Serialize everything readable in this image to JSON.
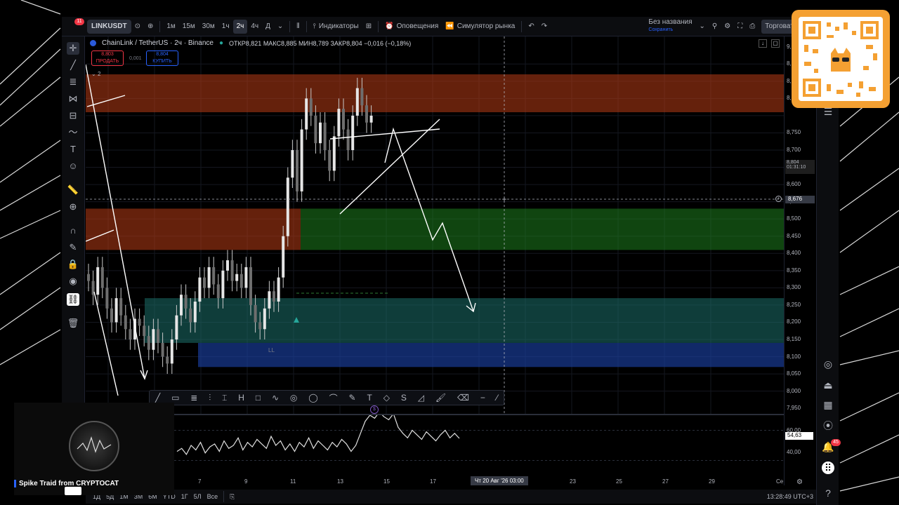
{
  "topbar": {
    "symbol": "LINKUSDT",
    "notification_count": "11",
    "intervals": [
      "1м",
      "15м",
      "30м",
      "1ч",
      "2ч",
      "4ч",
      "Д"
    ],
    "active_interval": "2ч",
    "indicators_label": "Индикаторы",
    "alerts_label": "Оповещения",
    "replay_label": "Симулятор рынка",
    "layout_name": "Без названия",
    "layout_status": "Сохранить",
    "trade_label": "Торговать"
  },
  "legend": {
    "title": "ChainLink / TetherUS · 2ч · Binance",
    "ohlc": "ОТКР8,821 МАКС8,885 МИН8,789 ЗАКР8,804 −0,016 (−0,18%)",
    "sell_price": "8,803",
    "sell_label": "ПРОДАТЬ",
    "spread": "0,001",
    "buy_price": "8,804",
    "buy_label": "КУПИТЬ",
    "collapse": "2"
  },
  "price_axis": {
    "labels": [
      "9,000",
      "8,950",
      "8,900",
      "8,850",
      "8,750",
      "8,700",
      "8,650",
      "8,600",
      "8,550",
      "8,500",
      "8,450",
      "8,400",
      "8,350",
      "8,300",
      "8,250",
      "8,200",
      "8,150",
      "8,100",
      "8,050",
      "8,000",
      "7,950"
    ],
    "current_price": "8,804",
    "countdown": "01:31:10",
    "crosshair_price": "8,676",
    "rsi_labels": [
      "60,00",
      "40,00"
    ],
    "rsi_value": "54,63"
  },
  "time_axis": {
    "labels": [
      "7",
      "9",
      "11",
      "13",
      "15",
      "17",
      "23",
      "25",
      "27",
      "29",
      "Се"
    ],
    "crosshair_time": "Чт 20 Авг '26   03:00"
  },
  "marks": {
    "ll": "LL"
  },
  "bottombar": {
    "ranges": [
      "1Д",
      "5Д",
      "1М",
      "3М",
      "6М",
      "YTD",
      "1Г",
      "5Л",
      "Все"
    ],
    "clock": "13:28:49 UTC+3"
  },
  "stream": {
    "caption": "Spike Traid from CRYPTOCAT"
  },
  "right_toolbar": {
    "notification_badge": "45"
  },
  "colors": {
    "resistance_zone": "#b83c16",
    "demand_zone": "#1f8a1f",
    "support_zone_teal": "#1b6f6a",
    "support_zone_blue": "#1a3fa0",
    "qr_frame": "#f4a032",
    "accent_blue": "#2962ff"
  },
  "chart_data": {
    "type": "candlestick",
    "title": "ChainLink / TetherUS · 2ч · Binance",
    "xlabel": "",
    "ylabel": "",
    "ylim": [
      7.93,
      9.03
    ],
    "x_ticks": [
      "7",
      "9",
      "11",
      "13",
      "15",
      "17",
      "23",
      "25",
      "27",
      "29"
    ],
    "zones": [
      {
        "name": "resistance",
        "low": 8.81,
        "high": 8.92
      },
      {
        "name": "supply",
        "low": 8.41,
        "high": 8.53
      },
      {
        "name": "demand",
        "low": 8.41,
        "high": 8.53
      },
      {
        "name": "support_teal",
        "low": 8.14,
        "high": 8.27
      },
      {
        "name": "support_blue",
        "low": 8.07,
        "high": 8.14
      }
    ],
    "close_series": [
      8.32,
      8.28,
      8.36,
      8.3,
      8.24,
      8.2,
      8.27,
      8.22,
      8.18,
      8.15,
      8.21,
      8.19,
      8.16,
      8.12,
      8.18,
      8.14,
      8.1,
      8.08,
      8.15,
      8.22,
      8.28,
      8.24,
      8.2,
      8.26,
      8.33,
      8.3,
      8.36,
      8.31,
      8.27,
      8.35,
      8.38,
      8.32,
      8.34,
      8.3,
      8.36,
      8.25,
      8.2,
      8.18,
      8.24,
      8.29,
      8.26,
      8.33,
      8.45,
      8.62,
      8.7,
      8.58,
      8.76,
      8.85,
      8.8,
      8.72,
      8.78,
      8.7,
      8.64,
      8.74,
      8.82,
      8.76,
      8.7,
      8.8,
      8.88,
      8.83,
      8.78,
      8.8
    ],
    "rsi_ylim": [
      30,
      70
    ],
    "rsi_levels": [
      60,
      40
    ],
    "rsi_last": 54.63
  }
}
